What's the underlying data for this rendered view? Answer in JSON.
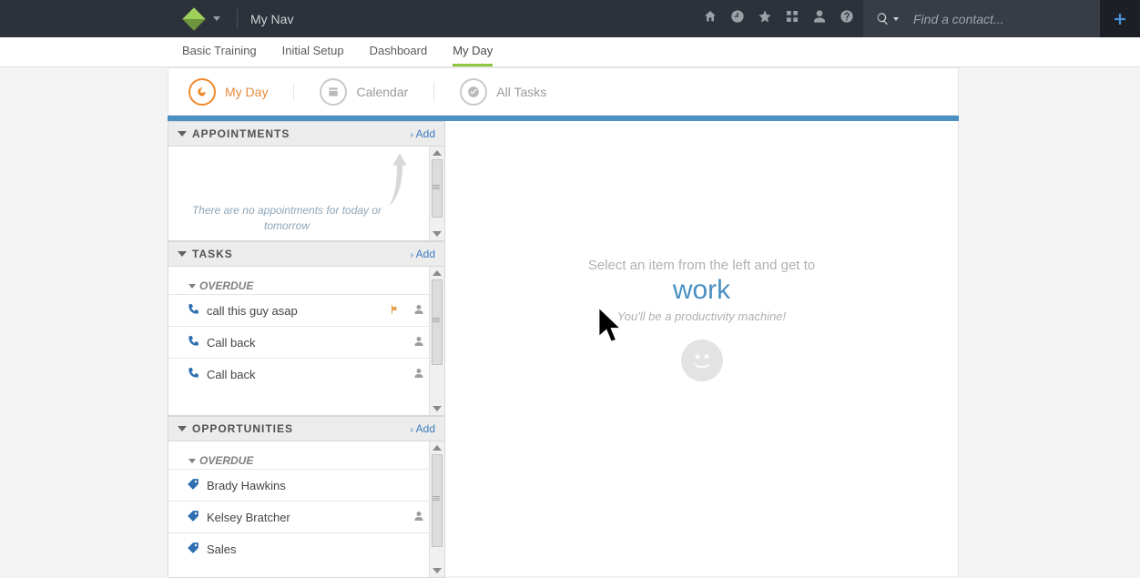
{
  "topbar": {
    "app_title": "My Nav"
  },
  "search": {
    "placeholder": "Find a contact..."
  },
  "navtabs": [
    {
      "label": "Basic Training"
    },
    {
      "label": "Initial Setup"
    },
    {
      "label": "Dashboard"
    },
    {
      "label": "My Day",
      "active": true
    }
  ],
  "subtabs": [
    {
      "label": "My Day",
      "active": true
    },
    {
      "label": "Calendar"
    },
    {
      "label": "All Tasks"
    }
  ],
  "sections": {
    "appointments": {
      "title": "APPOINTMENTS",
      "add_label": "Add",
      "empty_text": "There are no appointments for today or tomorrow"
    },
    "tasks": {
      "title": "TASKS",
      "add_label": "Add",
      "overdue_label": "OVERDUE",
      "items": [
        {
          "label": "call this guy asap",
          "flagged": true
        },
        {
          "label": "Call back"
        },
        {
          "label": "Call back"
        }
      ]
    },
    "opportunities": {
      "title": "OPPORTUNITIES",
      "add_label": "Add",
      "overdue_label": "OVERDUE",
      "items": [
        {
          "label": "Brady Hawkins"
        },
        {
          "label": "Kelsey Bratcher",
          "person": true
        },
        {
          "label": "Sales"
        }
      ]
    }
  },
  "placeholder": {
    "line1": "Select an item from the left and get to",
    "word": "work",
    "line2": "You'll be a productivity machine!"
  }
}
